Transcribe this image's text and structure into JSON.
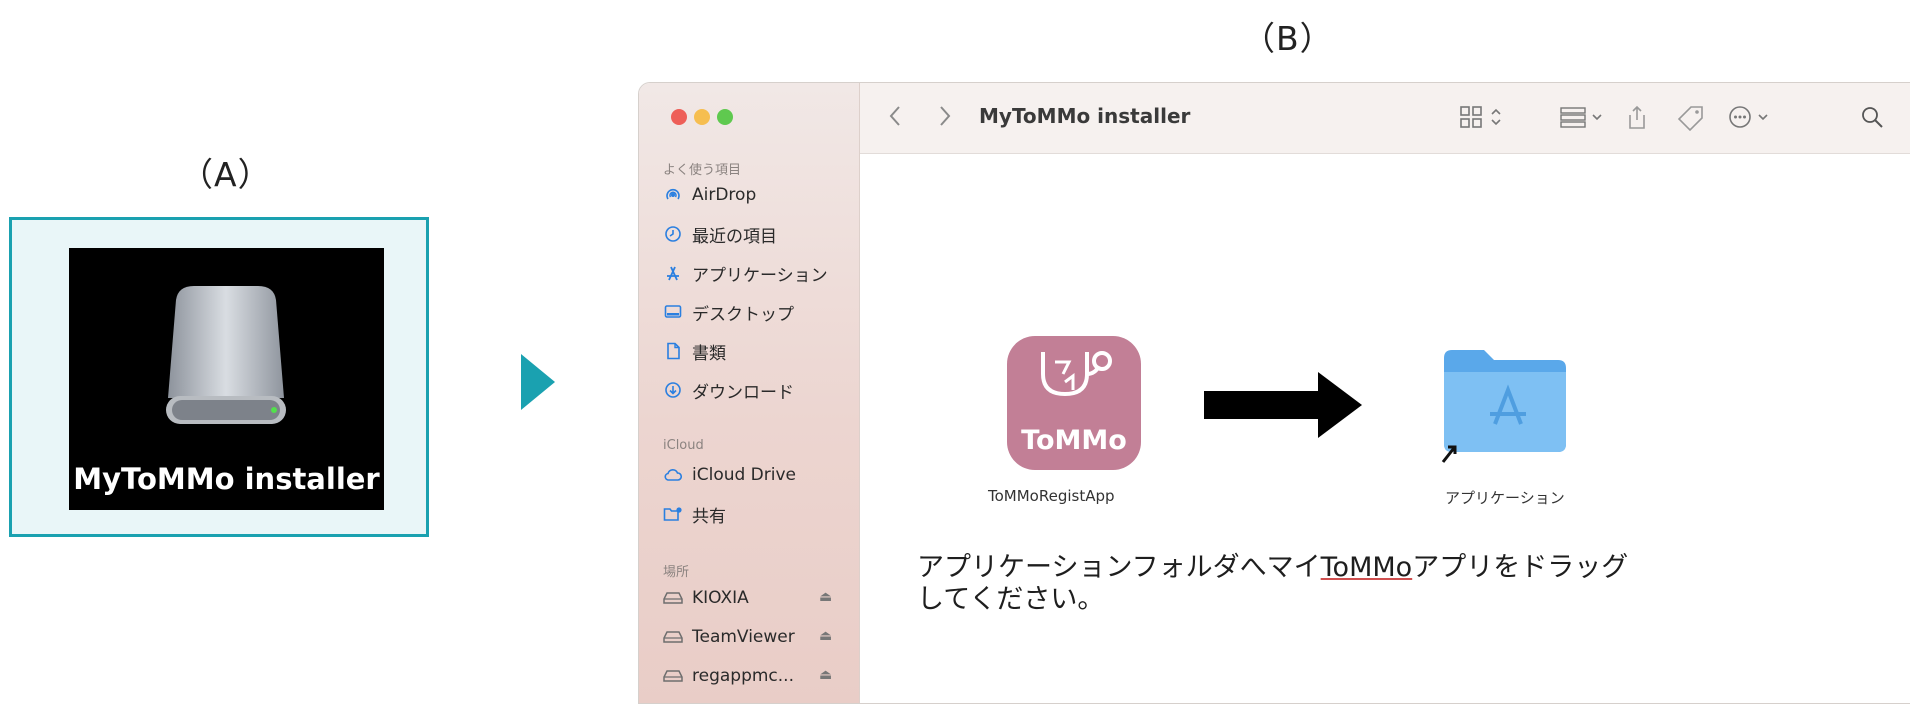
{
  "panel_a": {
    "label": "（A）",
    "disk_name": "MyToMMo installer",
    "border_color": "#1aa1b0",
    "icon": "external-disk-icon"
  },
  "panel_b": {
    "label": "（B）"
  },
  "finder": {
    "window_title": "MyToMMo installer",
    "sidebar": {
      "favorites_header": "よく使う項目",
      "favorites": [
        {
          "label": "AirDrop",
          "icon": "airdrop-icon"
        },
        {
          "label": "最近の項目",
          "icon": "clock-icon"
        },
        {
          "label": "アプリケーション",
          "icon": "applications-icon"
        },
        {
          "label": "デスクトップ",
          "icon": "desktop-icon"
        },
        {
          "label": "書類",
          "icon": "document-icon"
        },
        {
          "label": "ダウンロード",
          "icon": "download-icon"
        }
      ],
      "icloud_header": "iCloud",
      "icloud": [
        {
          "label": "iCloud Drive",
          "icon": "cloud-icon"
        },
        {
          "label": "共有",
          "icon": "shared-folder-icon"
        }
      ],
      "locations_header": "場所",
      "locations": [
        {
          "label": "KIOXIA",
          "icon": "drive-icon"
        },
        {
          "label": "TeamViewer",
          "icon": "drive-icon"
        },
        {
          "label": "regappmc...",
          "icon": "drive-icon"
        }
      ]
    },
    "content": {
      "app_icon_text": "ToMMo",
      "app_name": "ToMMoRegistApp",
      "folder_name": "アプリケーション",
      "instruction_part1": "アプリケーションフォルダへマイ",
      "instruction_underlined": "ToMMo",
      "instruction_part2": "アプリをドラッグ",
      "instruction_line2": "してください。"
    }
  },
  "colors": {
    "accent": "#1aa1b0",
    "app_icon": "#c27f96",
    "folder": "#6fb6ef"
  }
}
